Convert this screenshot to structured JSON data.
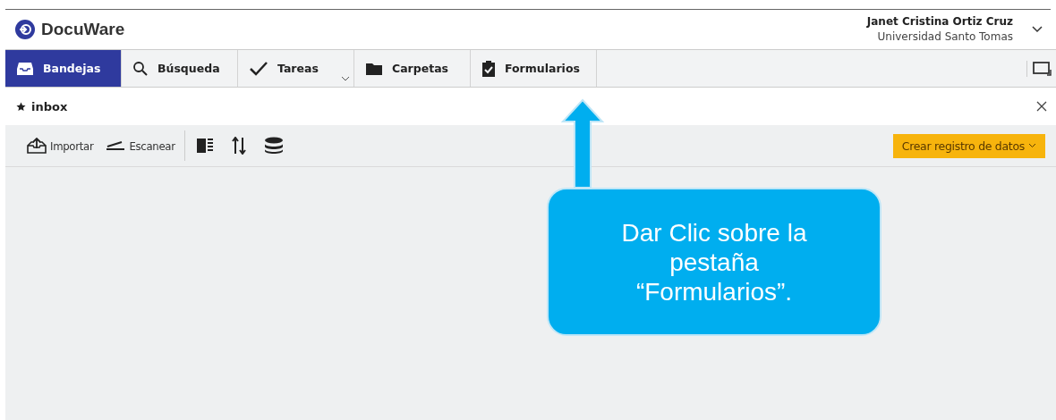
{
  "app": {
    "name": "DocuWare"
  },
  "user": {
    "name": "Janet Cristina Ortiz Cruz",
    "organization": "Universidad Santo Tomas"
  },
  "tabs": [
    {
      "label": "Bandejas",
      "kind": "tray",
      "selected": true,
      "dropdown": false
    },
    {
      "label": "Búsqueda",
      "kind": "search",
      "selected": false,
      "dropdown": false
    },
    {
      "label": "Tareas",
      "kind": "check",
      "selected": false,
      "dropdown": true
    },
    {
      "label": "Carpetas",
      "kind": "folder",
      "selected": false,
      "dropdown": false
    },
    {
      "label": "Formularios",
      "kind": "clipboard",
      "selected": false,
      "dropdown": false
    }
  ],
  "panel": {
    "title": "inbox"
  },
  "toolbar": [
    {
      "label": "Importar",
      "kind": "import"
    },
    {
      "label": "Escanear",
      "kind": "scan"
    }
  ],
  "create_button": {
    "label": "Crear registro de datos"
  },
  "callout": {
    "text": "Dar Clic sobre la pestaña “Formularios”."
  }
}
